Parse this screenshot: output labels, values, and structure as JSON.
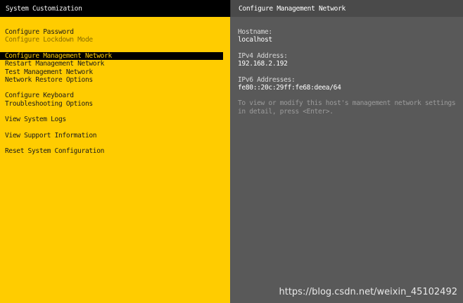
{
  "left_pane": {
    "title": "System Customization",
    "menu_items": [
      {
        "label": "Configure Password"
      },
      {
        "label": "Configure Lockdown Mode"
      },
      {
        "label": "Configure Management Network"
      },
      {
        "label": "Restart Management Network"
      },
      {
        "label": "Test Management Network"
      },
      {
        "label": "Network Restore Options"
      },
      {
        "label": "Configure Keyboard"
      },
      {
        "label": "Troubleshooting Options"
      },
      {
        "label": "View System Logs"
      },
      {
        "label": "View Support Information"
      },
      {
        "label": "Reset System Configuration"
      }
    ],
    "selected_item": "Configure Management Network"
  },
  "right_pane": {
    "title": "Configure Management Network",
    "hostname_label": "Hostname:",
    "hostname_value": "localhost",
    "ipv4_label": "IPv4 Address:",
    "ipv4_value": "192.168.2.192",
    "ipv6_label": "IPv6 Addresses:",
    "ipv6_value": "fe80::20c:29ff:fe68:deea/64",
    "hint": "To view or modify this host's management network settings in detail, press <Enter>."
  },
  "watermark": "https://blog.csdn.net/weixin_45102492",
  "colors": {
    "left_background": "#ffcc00",
    "right_background": "#595959",
    "header_background": "#000000",
    "selected_background": "#000000"
  }
}
